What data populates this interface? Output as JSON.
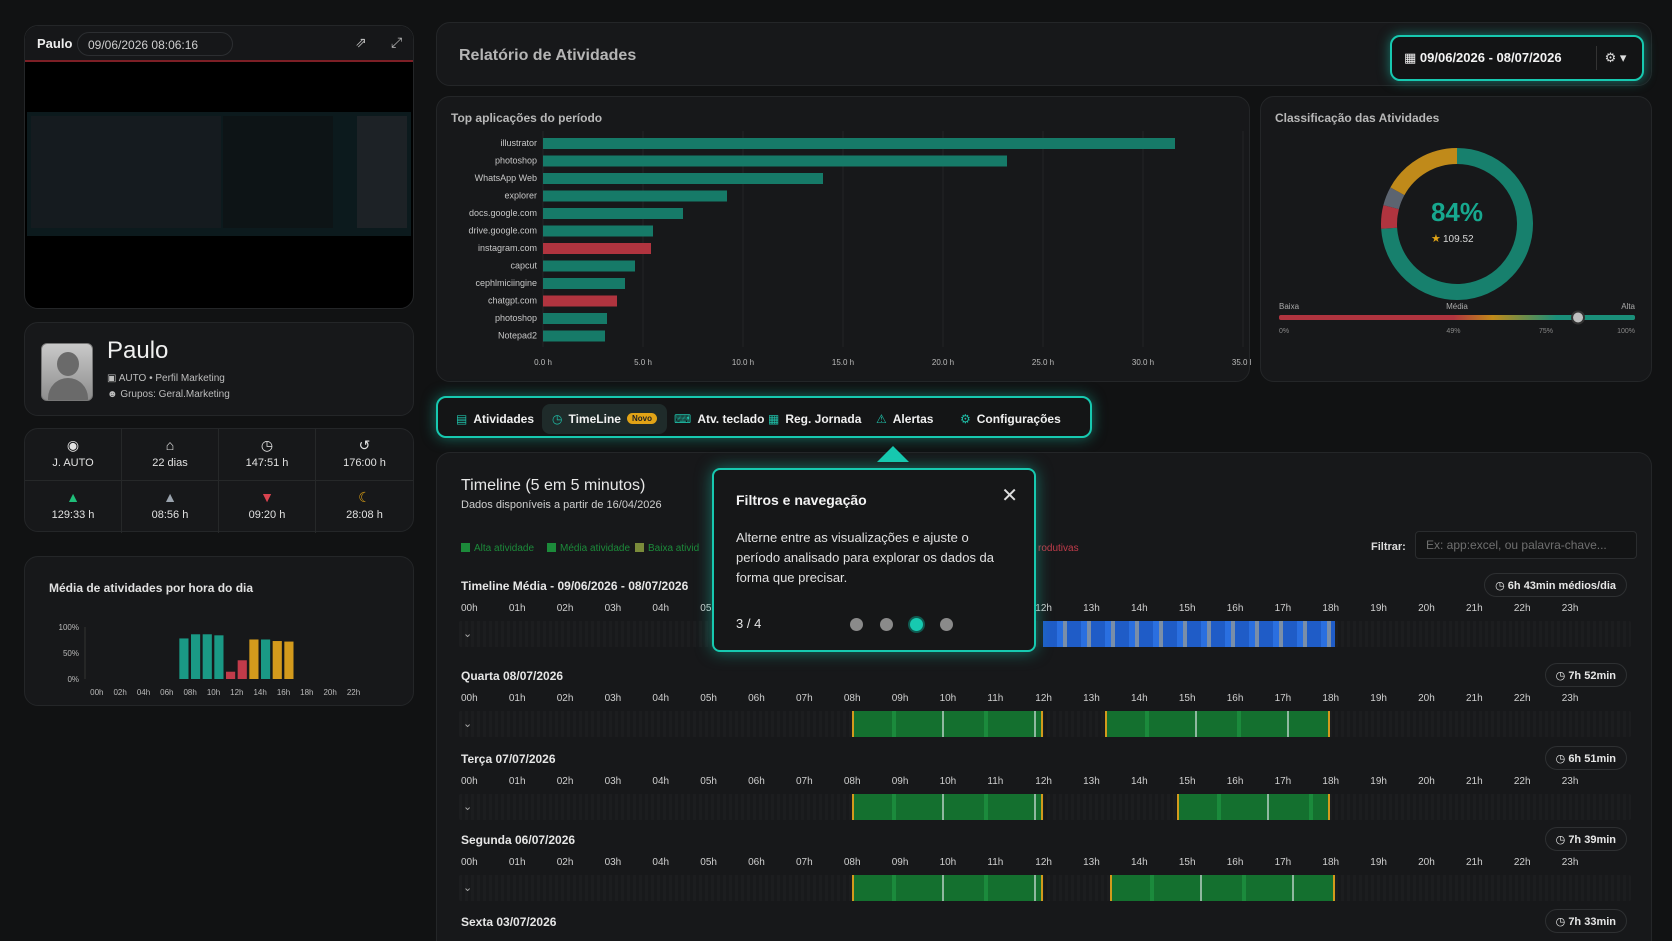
{
  "preview": {
    "user": "Paulo",
    "datetime": "09/06/2026 08:06:16",
    "open_icon": "external-link-icon",
    "expand_icon": "expand-icon"
  },
  "profile": {
    "name": "Paulo",
    "line1": "AUTO • Perfil Marketing",
    "line2": "Grupos: Geral.Marketing"
  },
  "stats": [
    {
      "icon": "dashboard-icon",
      "glyph": "◉",
      "value": "J. AUTO",
      "color": "#e2e2e2"
    },
    {
      "icon": "home-icon",
      "glyph": "⌂",
      "value": "22 dias",
      "color": "#e2e2e2"
    },
    {
      "icon": "clock-icon",
      "glyph": "◷",
      "value": "147:51 h",
      "color": "#e2e2e2"
    },
    {
      "icon": "history-icon",
      "glyph": "↺",
      "value": "176:00 h",
      "color": "#e2e2e2"
    },
    {
      "icon": "thumbs-up-icon",
      "glyph": "▲",
      "value": "129:33 h",
      "color": "#1fbf7a"
    },
    {
      "icon": "thumbs-up-outline-icon",
      "glyph": "▲",
      "value": "08:56 h",
      "color": "#9aa3ad"
    },
    {
      "icon": "thumbs-down-icon",
      "glyph": "▼",
      "value": "09:20 h",
      "color": "#d9434f"
    },
    {
      "icon": "moon-icon",
      "glyph": "☾",
      "value": "28:08 h",
      "color": "#e0a316"
    }
  ],
  "hourly": {
    "title": "Média de atividades por hora do dia",
    "chart_data": {
      "type": "bar",
      "ylabels": [
        "100%",
        "50%",
        "0%"
      ],
      "xlabels": [
        "00h",
        "02h",
        "04h",
        "06h",
        "08h",
        "10h",
        "12h",
        "14h",
        "16h",
        "18h",
        "20h",
        "22h"
      ],
      "values": [
        0,
        0,
        0,
        0,
        0,
        0,
        0,
        0,
        0.78,
        0.86,
        0.86,
        0.84,
        0.14,
        0.36,
        0.76,
        0.76,
        0.73,
        0.72,
        0,
        0,
        0,
        0,
        0,
        0
      ],
      "colors": [
        "#1a9985",
        "#1a9985",
        "#1a9985",
        "#1a9985",
        "#1a9985",
        "#1a9985",
        "#1a9985",
        "#1a9985",
        "#1a9985",
        "#1a9985",
        "#1a9985",
        "#1a9985",
        "#c23b4a",
        "#c23b4a",
        "#d39a1c",
        "#1a9985",
        "#d39a1c",
        "#d39a1c",
        "#1a9985",
        "#1a9985",
        "#1a9985",
        "#1a9985",
        "#1a9985",
        "#1a9985"
      ]
    }
  },
  "header": {
    "title": "Relatório de Atividades",
    "date_range": "09/06/2026 - 08/07/2026"
  },
  "top_apps": {
    "title": "Top aplicações do período",
    "chart_data": {
      "type": "bar",
      "orientation": "horizontal",
      "categories": [
        "illustrator",
        "photoshop",
        "WhatsApp Web",
        "explorer",
        "docs.google.com",
        "drive.google.com",
        "instagram.com",
        "capcut",
        "cephlmiciingine",
        "chatgpt.com",
        "photoshop",
        "Notepad2"
      ],
      "values": [
        31.6,
        23.2,
        14.0,
        9.2,
        7.0,
        5.5,
        5.4,
        4.6,
        4.1,
        3.7,
        3.2,
        3.1
      ],
      "colors": [
        "#167a68",
        "#167a68",
        "#167a68",
        "#167a68",
        "#167a68",
        "#167a68",
        "#b0343f",
        "#167a68",
        "#167a68",
        "#b0343f",
        "#167a68",
        "#167a68"
      ],
      "xticks": [
        "0.0 h",
        "5.0 h",
        "10.0 h",
        "15.0 h",
        "20.0 h",
        "25.0 h",
        "30.0 h",
        "35.0 h"
      ],
      "xlim": [
        0,
        35
      ]
    }
  },
  "classification": {
    "title": "Classificação das Atividades",
    "percent": "84%",
    "score": "109.52",
    "chart_data": {
      "type": "pie",
      "slices": [
        {
          "label": "Alta",
          "value": 0.74,
          "color": "#17806d"
        },
        {
          "label": "Baixa",
          "value": 0.05,
          "color": "#b0343f"
        },
        {
          "label": "Neutra",
          "value": 0.04,
          "color": "#5c6470"
        },
        {
          "label": "Média",
          "value": 0.17,
          "color": "#c08a1a"
        }
      ]
    },
    "scale_labels": [
      "Baixa",
      "Média",
      "Alta"
    ],
    "scale_ticks": [
      "0%",
      "49%",
      "75%",
      "100%"
    ],
    "scale_position": 0.84
  },
  "tabs": [
    {
      "label": "Atividades",
      "icon": "list-icon",
      "glyph": "▤",
      "active": false
    },
    {
      "label": "TimeLine",
      "icon": "clock-icon",
      "glyph": "◷",
      "active": true,
      "badge": "Novo"
    },
    {
      "label": "Atv. teclado",
      "icon": "keyboard-icon",
      "glyph": "⌨",
      "active": false
    },
    {
      "label": "Reg. Jornada",
      "icon": "calendar-icon",
      "glyph": "▦",
      "active": false
    },
    {
      "label": "Alertas",
      "icon": "alert-icon",
      "glyph": "⚠",
      "active": false
    },
    {
      "label": "Configurações",
      "icon": "gear-icon",
      "glyph": "⚙",
      "active": false
    }
  ],
  "timeline": {
    "title": "Timeline (5 em 5 minutos)",
    "subtitle": "Dados disponíveis a partir de 16/04/2026",
    "legend": [
      {
        "label": "Alta atividade",
        "color": "#1c8a3a"
      },
      {
        "label": "Média atividade",
        "color": "#1c8a3a"
      },
      {
        "label": "Baixa ativid",
        "color": "#7a8a3a"
      },
      {
        "label": "rodutivas",
        "color": "#c23b4a"
      }
    ],
    "filter_label": "Filtrar:",
    "filter_placeholder": "Ex: app:excel, ou palavra-chave...",
    "hours": [
      "00h",
      "01h",
      "02h",
      "03h",
      "04h",
      "05h",
      "06h",
      "07h",
      "08h",
      "09h",
      "10h",
      "11h",
      "12h",
      "13h",
      "14h",
      "15h",
      "16h",
      "17h",
      "18h",
      "19h",
      "20h",
      "21h",
      "22h",
      "23h"
    ],
    "rows": [
      {
        "label": "Timeline Média - 09/06/2026 - 08/07/2026",
        "total": "6h 43min médios/dia",
        "style": "average",
        "segments": [
          [
            12.0,
            18.1,
            "#1f5cc7"
          ]
        ]
      },
      {
        "label": "Quarta 08/07/2026",
        "total": "7h 52min",
        "style": "day",
        "segments": [
          [
            8.0,
            12.0,
            "#14702f"
          ],
          [
            13.3,
            18.0,
            "#14702f"
          ]
        ]
      },
      {
        "label": "Terça 07/07/2026",
        "total": "6h 51min",
        "style": "day",
        "segments": [
          [
            8.0,
            12.0,
            "#14702f"
          ],
          [
            14.8,
            18.0,
            "#14702f"
          ]
        ]
      },
      {
        "label": "Segunda 06/07/2026",
        "total": "7h 39min",
        "style": "day",
        "segments": [
          [
            8.0,
            12.0,
            "#14702f"
          ],
          [
            13.4,
            18.1,
            "#14702f"
          ]
        ]
      },
      {
        "label": "Sexta 03/07/2026",
        "total": "7h 33min",
        "style": "day",
        "segments": []
      }
    ]
  },
  "popover": {
    "title": "Filtros e navegação",
    "text": "Alterne entre as visualizações e ajuste o período analisado para explorar os dados da forma que precisar.",
    "step": "3 / 4",
    "active_dot": 3,
    "total_dots": 4
  }
}
